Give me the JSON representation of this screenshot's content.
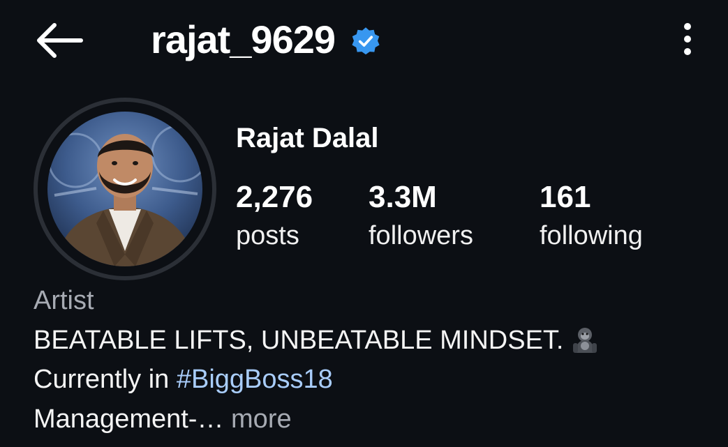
{
  "header": {
    "username": "rajat_9629",
    "verified": true
  },
  "profile": {
    "display_name": "Rajat Dalal",
    "stats": {
      "posts_count": "2,276",
      "posts_label": "posts",
      "followers_count": "3.3M",
      "followers_label": "followers",
      "following_count": "161",
      "following_label": "following"
    },
    "category": "Artist",
    "bio": {
      "line1": "BEATABLE LIFTS, UNBEATABLE MINDSET.",
      "line2_prefix": "Currently in ",
      "line2_hashtag": "#BiggBoss18",
      "line3": "Management-…",
      "more_label": " more"
    }
  },
  "colors": {
    "background": "#0c0f14",
    "verified_badge": "#3897f0",
    "hashtag": "#a9cdfb",
    "muted_text": "#a7abb3"
  },
  "icons": [
    "back-arrow-icon",
    "verified-badge-icon",
    "more-options-icon",
    "gorilla-emoji-icon"
  ]
}
